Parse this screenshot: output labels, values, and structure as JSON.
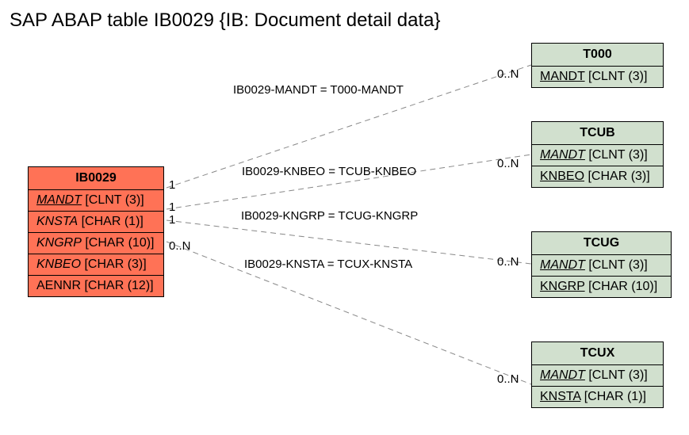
{
  "title": "SAP ABAP table IB0029 {IB: Document detail data}",
  "tables": {
    "main": {
      "name": "IB0029",
      "fields": [
        {
          "name": "MANDT",
          "type": "[CLNT (3)]",
          "italic": true,
          "underline": true
        },
        {
          "name": "KNSTA",
          "type": "[CHAR (1)]",
          "italic": true
        },
        {
          "name": "KNGRP",
          "type": "[CHAR (10)]",
          "italic": true
        },
        {
          "name": "KNBEO",
          "type": "[CHAR (3)]",
          "italic": true
        },
        {
          "name": "AENNR",
          "type": "[CHAR (12)]",
          "italic": false
        }
      ]
    },
    "t000": {
      "name": "T000",
      "fields": [
        {
          "name": "MANDT",
          "type": "[CLNT (3)]",
          "italic": false,
          "underline": true
        }
      ]
    },
    "tcub": {
      "name": "TCUB",
      "fields": [
        {
          "name": "MANDT",
          "type": "[CLNT (3)]",
          "italic": true,
          "underline": true
        },
        {
          "name": "KNBEO",
          "type": "[CHAR (3)]",
          "italic": false,
          "underline": true
        }
      ]
    },
    "tcug": {
      "name": "TCUG",
      "fields": [
        {
          "name": "MANDT",
          "type": "[CLNT (3)]",
          "italic": true,
          "underline": true
        },
        {
          "name": "KNGRP",
          "type": "[CHAR (10)]",
          "italic": false,
          "underline": true
        }
      ]
    },
    "tcux": {
      "name": "TCUX",
      "fields": [
        {
          "name": "MANDT",
          "type": "[CLNT (3)]",
          "italic": true,
          "underline": true
        },
        {
          "name": "KNSTA",
          "type": "[CHAR (1)]",
          "italic": false,
          "underline": true
        }
      ]
    }
  },
  "edges": [
    {
      "label": "IB0029-MANDT = T000-MANDT",
      "from_card": "1",
      "to_card": "0..N"
    },
    {
      "label": "IB0029-KNBEO = TCUB-KNBEO",
      "from_card": "1",
      "to_card": "0..N"
    },
    {
      "label": "IB0029-KNGRP = TCUG-KNGRP",
      "from_card": "1",
      "to_card": "0..N"
    },
    {
      "label": "IB0029-KNSTA = TCUX-KNSTA",
      "from_card": "0..N",
      "to_card": "0..N"
    }
  ]
}
